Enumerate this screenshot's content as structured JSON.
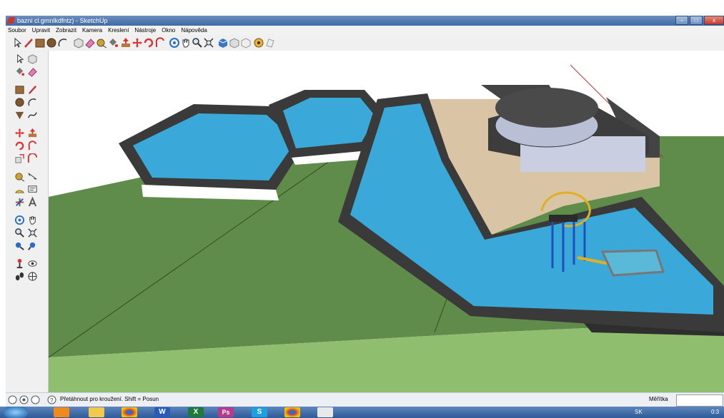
{
  "window": {
    "title": "bazni cl.gmnlkdfntz) - SketchUp"
  },
  "menu": [
    "Soubor",
    "Upravit",
    "Zobrazit",
    "Kamera",
    "Kreslení",
    "Nástroje",
    "Okno",
    "Nápověda"
  ],
  "toolbar_icons": [
    "select-icon",
    "pencil-icon",
    "rectangle-icon",
    "circle-icon",
    "arc-icon",
    "make-component-icon",
    "eraser-icon",
    "tape-measure-icon",
    "paint-bucket-icon",
    "push-pull-icon",
    "move-icon",
    "rotate-icon",
    "follow-me-icon",
    "orbit-icon",
    "pan-icon",
    "zoom-icon",
    "zoom-extents-icon",
    "get-models-icon",
    "share-model-icon",
    "components-icon",
    "styles-icon",
    "layers-icon"
  ],
  "left_tools": [
    "select-icon",
    "make-component-icon",
    "paint-bucket-icon",
    "eraser-icon",
    "rectangle-icon",
    "line-icon",
    "circle-icon",
    "arc-icon",
    "polygon-icon",
    "freehand-icon",
    "move-icon",
    "push-pull-icon",
    "rotate-icon",
    "follow-me-icon",
    "scale-icon",
    "offset-icon",
    "tape-measure-icon",
    "dimension-icon",
    "protractor-icon",
    "text-icon",
    "axes-icon",
    "3d-text-icon",
    "orbit-icon",
    "pan-icon",
    "zoom-icon",
    "zoom-window-icon",
    "previous-view-icon",
    "next-view-icon",
    "position-camera-icon",
    "look-around-icon",
    "walk-icon",
    "section-plane-icon"
  ],
  "status": {
    "hint": "Přetáhnout pro kroužení.  Shift = Posun",
    "measure_label": "Měřítka"
  },
  "taskbar": {
    "apps": [
      "ie-icon",
      "explorer-icon",
      "chrome-icon",
      "word-icon",
      "excel-icon",
      "photoshop-icon",
      "skype-icon",
      "chrome-icon-2",
      "sketchup-icon"
    ],
    "word_label": "W",
    "excel_label": "X",
    "ps_label": "Ps",
    "skype_label": "S",
    "lang": "SK",
    "clock": "0:3"
  },
  "colors": {
    "sky": "#ffffff",
    "grass": "#5f8c4a",
    "water": "#3aa8d8",
    "rim": "#4a4a4a",
    "deck": "#d9c5a6"
  }
}
